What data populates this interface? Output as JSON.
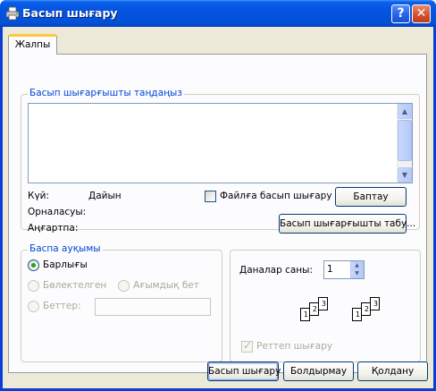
{
  "window": {
    "title": "Басып шығару",
    "help_label": "?",
    "close_label": "✕"
  },
  "tabs": [
    {
      "label": "Жалпы",
      "selected": true
    }
  ],
  "printer_group": {
    "legend": "Басып шығарғышты таңдаңыз",
    "printer_list": [],
    "status_label": "Күй:",
    "status_value": "Дайын",
    "location_label": "Орналасуы:",
    "location_value": "",
    "comment_label": "Аңғартпа:",
    "comment_value": "",
    "print_to_file_label": "Файлға басып шығару",
    "print_to_file_checked": false,
    "preferences_button": "Баптау",
    "find_printer_button": "Басып шығарғышты табу..."
  },
  "page_range": {
    "legend": "Баспа ауқымы",
    "all_label": "Барлығы",
    "selection_label": "Бөлектелген",
    "current_page_label": "Ағымдық бет",
    "pages_label": "Беттер:",
    "pages_value": "",
    "selected_option": "all"
  },
  "copies": {
    "label": "Даналар саны:",
    "value": "1",
    "collate_label": "Реттеп шығару",
    "collate_checked": true,
    "collate_pages": [
      "1",
      "2",
      "3",
      "1",
      "2",
      "3"
    ]
  },
  "footer": {
    "print_button": "Басып шығару",
    "cancel_button": "Болдырмау",
    "apply_button": "Қолдану"
  },
  "colors": {
    "titlebar": "#0553e0",
    "group_legend": "#0046d5",
    "dialog_bg": "#ece9d8",
    "tab_highlight": "#ffc83c"
  }
}
